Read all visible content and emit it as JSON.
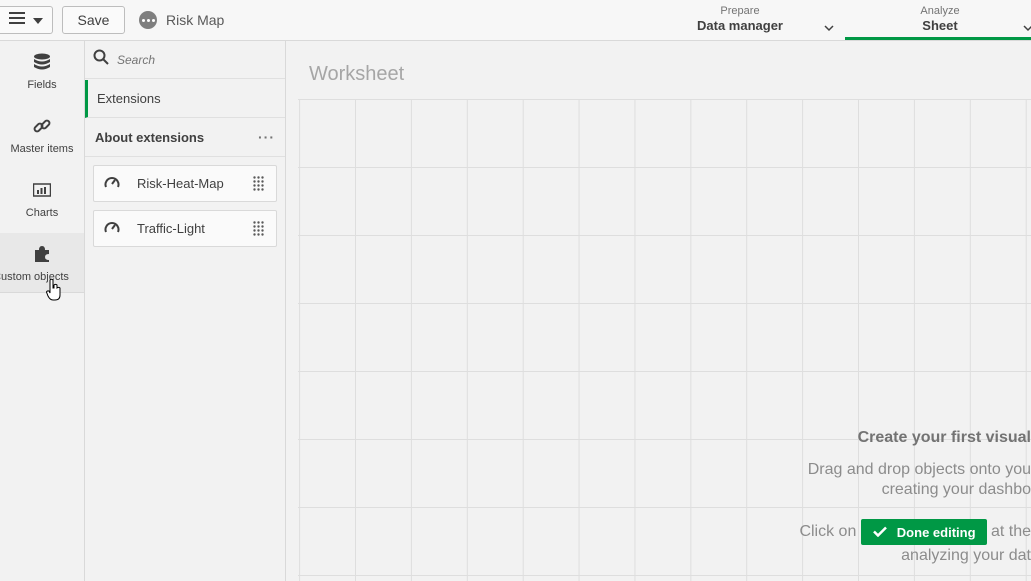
{
  "toolbar": {
    "save_label": "Save",
    "app_name": "Risk Map"
  },
  "nav": {
    "prepare": {
      "small": "Prepare",
      "big": "Data manager"
    },
    "analyze": {
      "small": "Analyze",
      "big": "Sheet"
    }
  },
  "rail": {
    "items": [
      {
        "label": "Fields",
        "icon": "database-icon"
      },
      {
        "label": "Master items",
        "icon": "link-icon"
      },
      {
        "label": "Charts",
        "icon": "bar-chart-icon"
      },
      {
        "label": "Custom objects",
        "icon": "puzzle-icon"
      }
    ]
  },
  "panel": {
    "search_placeholder": "Search",
    "tab_label": "Extensions",
    "section_title": "About extensions",
    "section_menu": "···",
    "extensions": [
      {
        "name": "Risk-Heat-Map",
        "icon": "gauge-icon"
      },
      {
        "name": "Traffic-Light",
        "icon": "gauge-icon"
      }
    ]
  },
  "canvas": {
    "sheet_title": "Worksheet",
    "hint_title": "Create your first visual",
    "hint_line1": "Drag and drop objects onto you",
    "hint_line2": "creating your dashbo",
    "hint_click": "Click on",
    "done_editing": "Done editing",
    "hint_at": "at the",
    "hint_line4": "analyzing your dat"
  },
  "colors": {
    "accent": "#009845",
    "background": "#f2f2f2",
    "gridline": "#dedede"
  }
}
